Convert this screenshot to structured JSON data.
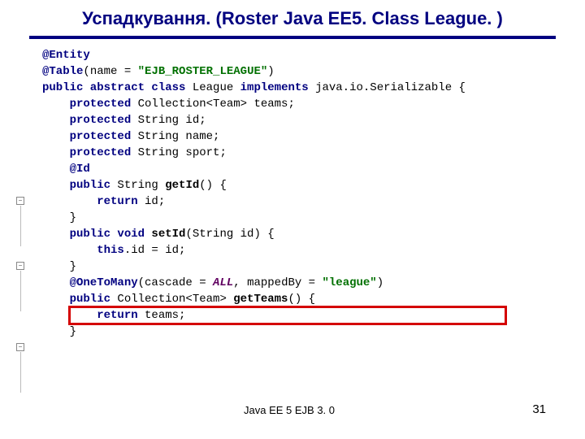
{
  "title": "Успадкування. (Roster Java EE5. Class League. )",
  "code": {
    "l1a": "@Entity",
    "l2a": "@Table",
    "l2b": "(name = ",
    "l2c": "\"EJB_ROSTER_LEAGUE\"",
    "l2d": ")",
    "l3a": "public abstract class ",
    "l3b": "League ",
    "l3c": "implements ",
    "l3d": "java.io.Serializable {",
    "l4a": "    protected ",
    "l4b": "Collection<Team> teams;",
    "l5a": "    protected ",
    "l5b": "String id;",
    "l6a": "    protected ",
    "l6b": "String name;",
    "l7a": "    protected ",
    "l7b": "String sport;",
    "blank": "",
    "l9a": "    @Id",
    "l10a": "    public ",
    "l10b": "String ",
    "l10c": "getId",
    "l10d": "() {",
    "l11a": "        return ",
    "l11b": "id;",
    "l12a": "    }",
    "l14a": "    public void ",
    "l14b": "setId",
    "l14c": "(String id) {",
    "l15a": "        this",
    "l15b": ".id = id;",
    "l16a": "    }",
    "l17a": "    @OneToMany",
    "l17b": "(cascade = ",
    "l17c": "ALL",
    "l17d": ", mappedBy = ",
    "l17e": "\"league\"",
    "l17f": ")",
    "l18a": "    public ",
    "l18b": "Collection<Team> ",
    "l18c": "getTeams",
    "l18d": "() {",
    "l19a": "        return ",
    "l19b": "teams;",
    "l20a": "    }"
  },
  "footer": "Java EE 5 EJB 3. 0",
  "page": "31"
}
